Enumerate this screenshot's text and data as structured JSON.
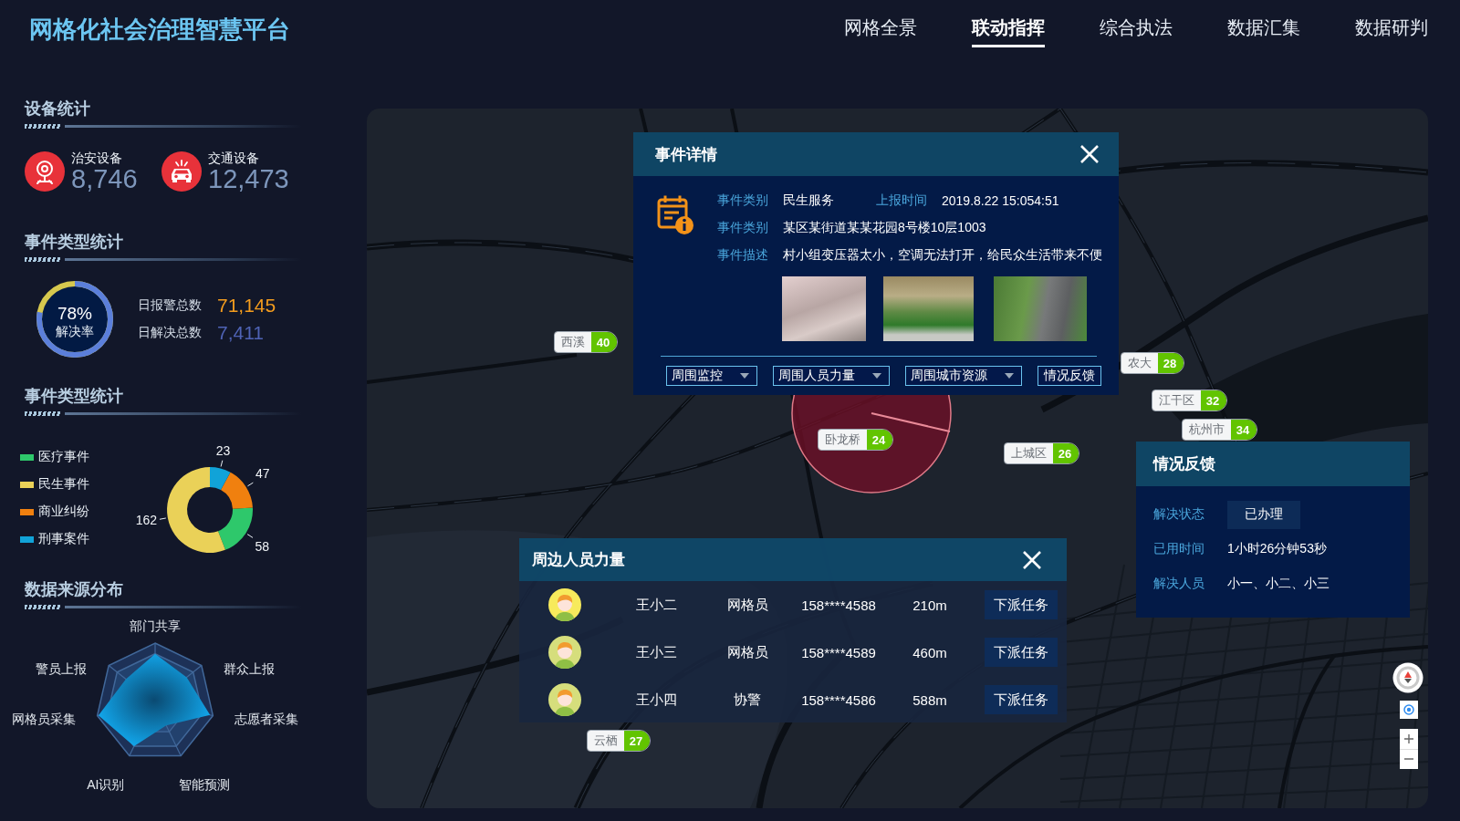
{
  "header": {
    "title": "网格化社会治理智慧平台",
    "nav": [
      {
        "label": "网格全景",
        "selected": false
      },
      {
        "label": "联动指挥",
        "selected": true
      },
      {
        "label": "综合执法",
        "selected": false
      },
      {
        "label": "数据汇集",
        "selected": false
      },
      {
        "label": "数据研判",
        "selected": false
      }
    ]
  },
  "device_stats": {
    "title": "设备统计",
    "items": [
      {
        "kind": "security",
        "label": "治安设备",
        "value": "8,746"
      },
      {
        "kind": "traffic",
        "label": "交通设备",
        "value": "12,473"
      }
    ]
  },
  "resolution_stats": {
    "title": "事件类型统计",
    "level": 0.78,
    "percent": "78%",
    "caption": "解决率",
    "rows": [
      {
        "label": "日报警总数",
        "value": "71,145",
        "color": "#f39c1e"
      },
      {
        "label": "日解决总数",
        "value": "7,411",
        "color": "#4f63b5"
      }
    ]
  },
  "event_types": {
    "title": "事件类型统计",
    "chart_data": {
      "type": "donut",
      "categories": [
        "医疗事件",
        "民生事件",
        "商业纠纷",
        "刑事案件"
      ],
      "values": [
        58,
        162,
        47,
        23
      ],
      "colors": [
        "#2ec86b",
        "#ead158",
        "#f0800f",
        "#11a3d8"
      ],
      "data_labels": true
    }
  },
  "data_sources": {
    "title": "数据来源分布",
    "axes": [
      "部门共享",
      "群众上报",
      "志愿者采集",
      "智能预测",
      "AI识别",
      "网格员采集",
      "警员上报"
    ]
  },
  "map": {
    "markers": [
      {
        "label": "西溪",
        "count": "40"
      },
      {
        "label": "卧龙桥",
        "count": "24"
      },
      {
        "label": "农大",
        "count": "28"
      },
      {
        "label": "江干区",
        "count": "32"
      },
      {
        "label": "杭州市",
        "count": "34"
      },
      {
        "label": "上城区",
        "count": "26"
      },
      {
        "label": "云栖",
        "count": "27"
      }
    ]
  },
  "event_detail": {
    "title": "事件详情",
    "rows": [
      {
        "fields": [
          {
            "label": "事件类别",
            "value": "民生服务"
          },
          {
            "label": "上报时间",
            "value": "2019.8.22 15:054:51"
          }
        ]
      },
      {
        "fields": [
          {
            "label": "事件类别",
            "value": "某区某街道某某花园8号楼10层1003"
          }
        ]
      },
      {
        "fields": [
          {
            "label": "事件描述",
            "value": "村小组变压器太小，空调无法打开，给民众生活带来不便"
          }
        ]
      }
    ],
    "actions": [
      {
        "kind": "select",
        "label": "周围监控"
      },
      {
        "kind": "select",
        "label": "周围人员力量"
      },
      {
        "kind": "select",
        "label": "周围城市资源"
      },
      {
        "kind": "button",
        "label": "情况反馈"
      }
    ]
  },
  "people_panel": {
    "title": "周边人员力量",
    "rows": [
      {
        "name": "王小二",
        "role": "网格员",
        "phone": "158****4588",
        "distance": "210m",
        "action": "下派任务",
        "color": "#f7ea5c"
      },
      {
        "name": "王小三",
        "role": "网格员",
        "phone": "158****4589",
        "distance": "460m",
        "action": "下派任务",
        "color": "#d6de7c"
      },
      {
        "name": "王小四",
        "role": "协警",
        "phone": "158****4586",
        "distance": "588m",
        "action": "下派任务",
        "color": "#d6de7c"
      }
    ]
  },
  "feedback": {
    "title": "情况反馈",
    "rows": [
      {
        "kind": "status",
        "label": "解决状态",
        "value": "已办理"
      },
      {
        "kind": "text",
        "label": "已用时间",
        "value": "1小时26分钟53秒"
      },
      {
        "kind": "text",
        "label": "解决人员",
        "value": "小一、小二、小三"
      }
    ]
  }
}
